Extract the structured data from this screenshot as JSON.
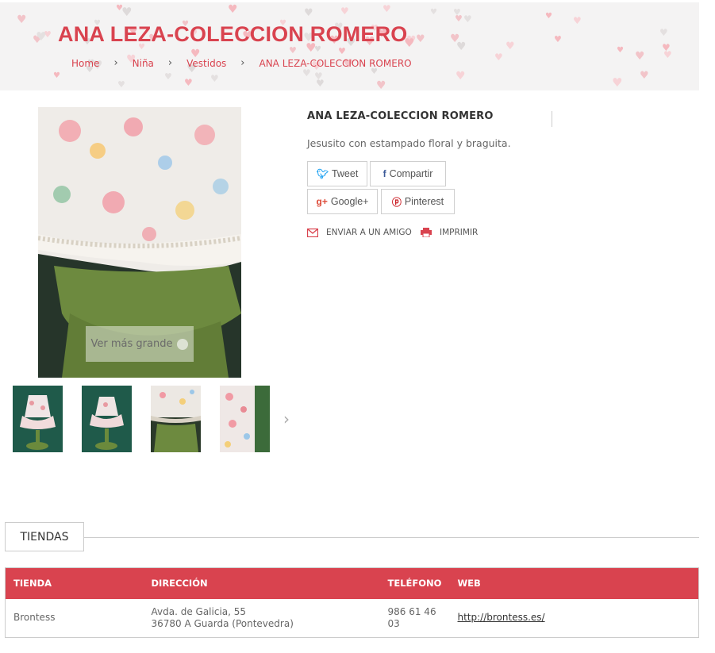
{
  "header": {
    "title": "ANA LEZA-COLECCION ROMERO",
    "breadcrumb": [
      "Home",
      "Niña",
      "Vestidos",
      "ANA LEZA-COLECCION ROMERO"
    ]
  },
  "product": {
    "name": "ANA LEZA-COLECCION ROMERO",
    "description": "Jesusito con estampado floral y braguita.",
    "zoom_label": "Ver más grande",
    "share": {
      "tweet": "Tweet",
      "compartir": "Compartir",
      "google": "Google+",
      "pinterest": "Pinterest"
    },
    "actions": {
      "send_friend": "ENVIAR A UN AMIGO",
      "print": "IMPRIMIR"
    }
  },
  "stores": {
    "tab_label": "TIENDAS",
    "columns": [
      "TIENDA",
      "DIRECCIÓN",
      "TELÉFONO",
      "WEB"
    ],
    "rows": [
      {
        "name": "Brontess",
        "address_line1": "Avda. de Galicia, 55",
        "address_line2": "36780 A Guarda (Pontevedra)",
        "phone_line1": "986 61 46",
        "phone_line2": "03",
        "web": "http://brontess.es/"
      }
    ]
  },
  "colors": {
    "accent": "#d9434f",
    "twitter": "#1da1f2",
    "facebook": "#3b5998",
    "google": "#dd4b39",
    "pinterest": "#cb2027"
  }
}
